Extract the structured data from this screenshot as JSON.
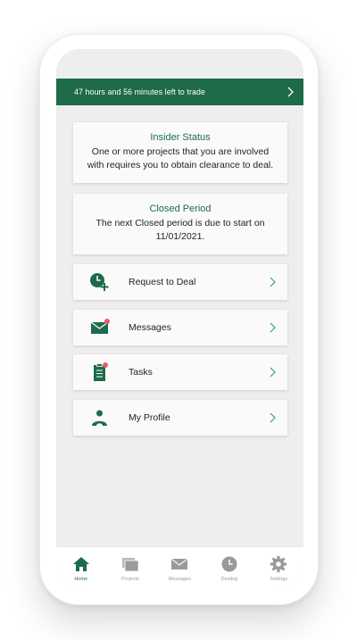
{
  "banner": {
    "text": "47 hours and 56 minutes left to trade"
  },
  "insider": {
    "heading": "Insider Status",
    "body": "One or more projects that you are involved with requires you to obtain clearance to deal."
  },
  "closed_period": {
    "heading": "Closed Period",
    "body": "The next Closed period is due to start on 11/01/2021."
  },
  "menu": [
    {
      "label": "Request to Deal",
      "icon": "clock-plus-icon"
    },
    {
      "label": "Messages",
      "icon": "envelope-icon"
    },
    {
      "label": "Tasks",
      "icon": "clipboard-icon"
    },
    {
      "label": "My Profile",
      "icon": "person-icon"
    }
  ],
  "tabs": [
    {
      "label": "Home",
      "icon": "home-icon",
      "active": true
    },
    {
      "label": "Projects",
      "icon": "folders-icon",
      "active": false
    },
    {
      "label": "Messages",
      "icon": "envelope-icon",
      "active": false
    },
    {
      "label": "Dealing",
      "icon": "clock-icon",
      "active": false
    },
    {
      "label": "Settings",
      "icon": "gear-icon",
      "active": false
    }
  ],
  "colors": {
    "brand_green": "#1e6b4a",
    "notification_dot": "#e85a6a",
    "inactive_icon": "#9a9a9a",
    "chevron_green": "#3aa35c"
  }
}
